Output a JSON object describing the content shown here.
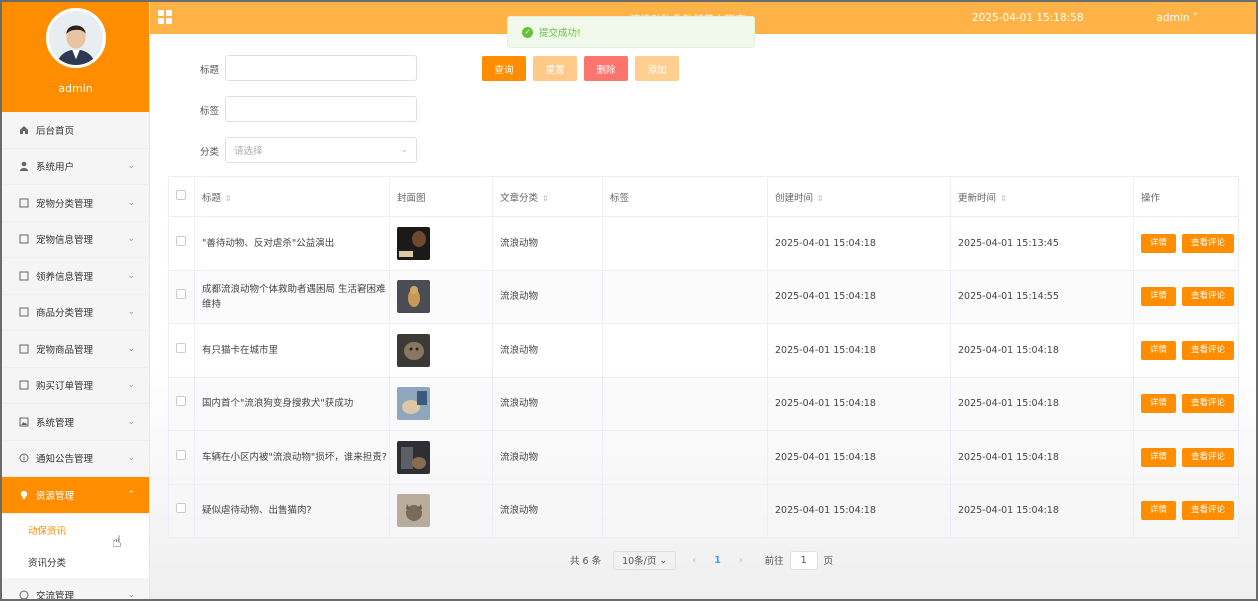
{
  "header": {
    "app_title": "流浪动物救助领养小程序",
    "datetime": "2025-04-01 15:18:58",
    "user": "admin"
  },
  "toast": {
    "message": "提交成功!"
  },
  "sidebar": {
    "username": "admin",
    "items": [
      {
        "label": "后台首页",
        "icon": "home-icon",
        "has_children": false
      },
      {
        "label": "系统用户",
        "icon": "user-icon",
        "has_children": true
      },
      {
        "label": "宠物分类管理",
        "icon": "doc-icon",
        "has_children": true
      },
      {
        "label": "宠物信息管理",
        "icon": "doc-icon",
        "has_children": true
      },
      {
        "label": "领养信息管理",
        "icon": "doc-icon",
        "has_children": true
      },
      {
        "label": "商品分类管理",
        "icon": "doc-icon",
        "has_children": true
      },
      {
        "label": "宠物商品管理",
        "icon": "doc-icon",
        "has_children": true
      },
      {
        "label": "购买订单管理",
        "icon": "doc-icon",
        "has_children": true
      },
      {
        "label": "系统管理",
        "icon": "image-icon",
        "has_children": true
      },
      {
        "label": "通知公告管理",
        "icon": "info-icon",
        "has_children": true
      },
      {
        "label": "资源管理",
        "icon": "bulb-icon",
        "has_children": true,
        "active": true
      }
    ],
    "subitems": [
      {
        "label": "动保资讯",
        "active": true
      },
      {
        "label": "资讯分类",
        "active": false
      }
    ],
    "partial_item": "交流管理"
  },
  "search": {
    "title_label": "标题",
    "tag_label": "标签",
    "category_label": "分类",
    "category_placeholder": "请选择",
    "title_value": "",
    "tag_value": ""
  },
  "actions": {
    "query": "查询",
    "reset": "重置",
    "delete": "删除",
    "add": "添加",
    "colors": {
      "query": "#ff8d00",
      "reset": "#ffc98a",
      "delete": "#fc746e",
      "add": "#ffcf8f"
    }
  },
  "table": {
    "headers": {
      "title": "标题",
      "cover": "封面图",
      "category": "文章分类",
      "tags": "标签",
      "created": "创建时间",
      "updated": "更新时间",
      "ops": "操作"
    },
    "detail_label": "详情",
    "comments_label": "查看评论",
    "rows": [
      {
        "title": "\"善待动物、反对虐杀\"公益演出",
        "category": "流浪动物",
        "tags": "",
        "created": "2025-04-01 15:04:18",
        "updated": "2025-04-01 15:13:45"
      },
      {
        "title": "成都流浪动物个体救助者遇困局 生活窘困难维持",
        "category": "流浪动物",
        "tags": "",
        "created": "2025-04-01 15:04:18",
        "updated": "2025-04-01 15:14:55"
      },
      {
        "title": "有只猫卡在城市里",
        "category": "流浪动物",
        "tags": "",
        "created": "2025-04-01 15:04:18",
        "updated": "2025-04-01 15:04:18"
      },
      {
        "title": "国内首个\"流浪狗变身搜救犬\"获成功",
        "category": "流浪动物",
        "tags": "",
        "created": "2025-04-01 15:04:18",
        "updated": "2025-04-01 15:04:18"
      },
      {
        "title": "车辆在小区内被\"流浪动物\"损坏，谁来担责?",
        "category": "流浪动物",
        "tags": "",
        "created": "2025-04-01 15:04:18",
        "updated": "2025-04-01 15:04:18"
      },
      {
        "title": "疑似虐待动物、出售猫肉?",
        "category": "流浪动物",
        "tags": "",
        "created": "2025-04-01 15:04:18",
        "updated": "2025-04-01 15:04:18"
      }
    ]
  },
  "pagination": {
    "total": "共 6 条",
    "page_size": "10条/页",
    "current_page": "1",
    "goto_label": "前往",
    "goto_value": "1",
    "page_suffix": "页"
  }
}
